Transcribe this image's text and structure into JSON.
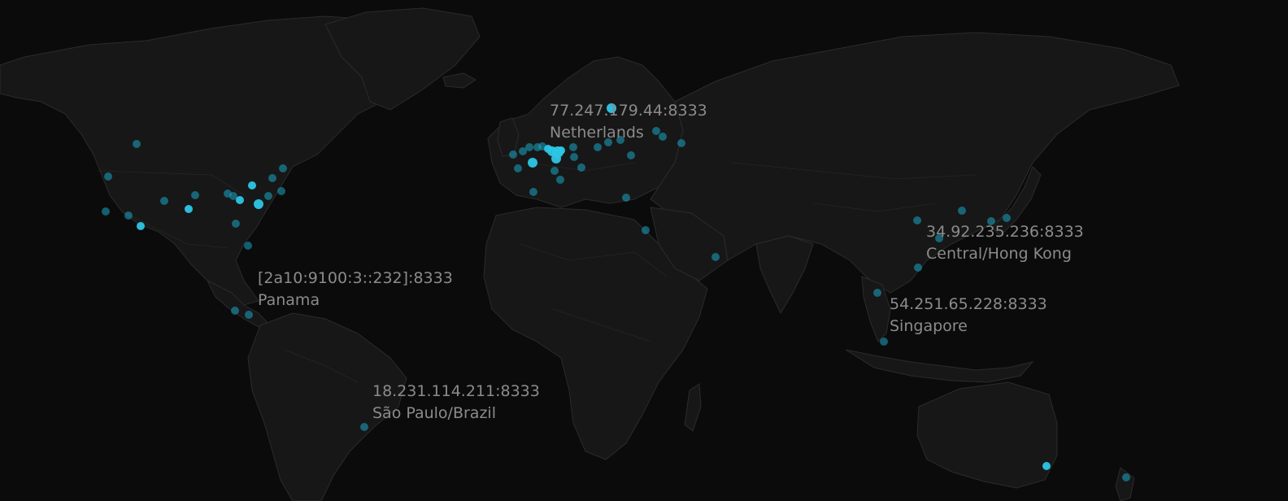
{
  "colors": {
    "background": "#0b0b0b",
    "land": "#171717",
    "border": "#2b2b2b",
    "node": "#1aa6c4",
    "label": "#8b8b8b"
  },
  "labels": [
    {
      "address": "77.247.179.44:8333",
      "location": "Netherlands"
    },
    {
      "address": "34.92.235.236:8333",
      "location": "Central/Hong Kong"
    },
    {
      "address": "[2a10:9100:3::232]:8333",
      "location": "Panama"
    },
    {
      "address": "54.251.65.228:8333",
      "location": "Singapore"
    },
    {
      "address": "18.231.114.211:8333",
      "location": "São Paulo/Brazil"
    }
  ]
}
